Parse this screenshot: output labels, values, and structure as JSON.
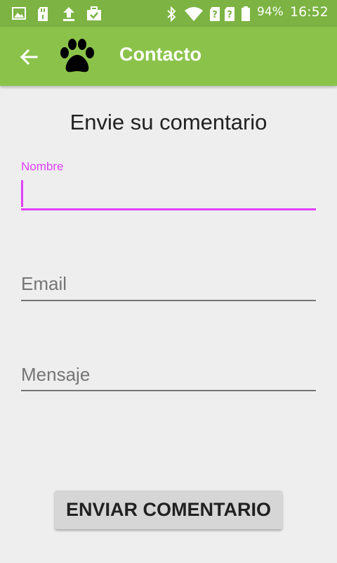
{
  "status_bar": {
    "battery_percent": "94%",
    "time": "16:52",
    "icons": [
      "image-icon",
      "sd-card-icon",
      "upload-icon",
      "briefcase-check-icon",
      "bluetooth-icon",
      "wifi-icon",
      "no-sim-icon",
      "no-sim-icon",
      "battery-icon"
    ]
  },
  "app_bar": {
    "title": "Contacto",
    "logo_icon": "paw-icon",
    "back_icon": "arrow-back-icon"
  },
  "form": {
    "heading": "Envie su comentario",
    "name_label": "Nombre",
    "name_value": "",
    "email_placeholder": "Email",
    "message_placeholder": "Mensaje",
    "submit_label": "ENVIAR COMENTARIO"
  },
  "colors": {
    "status_bar": "#7cb342",
    "app_bar": "#8bc34a",
    "accent": "#e040fb",
    "background": "#eeeeee"
  }
}
